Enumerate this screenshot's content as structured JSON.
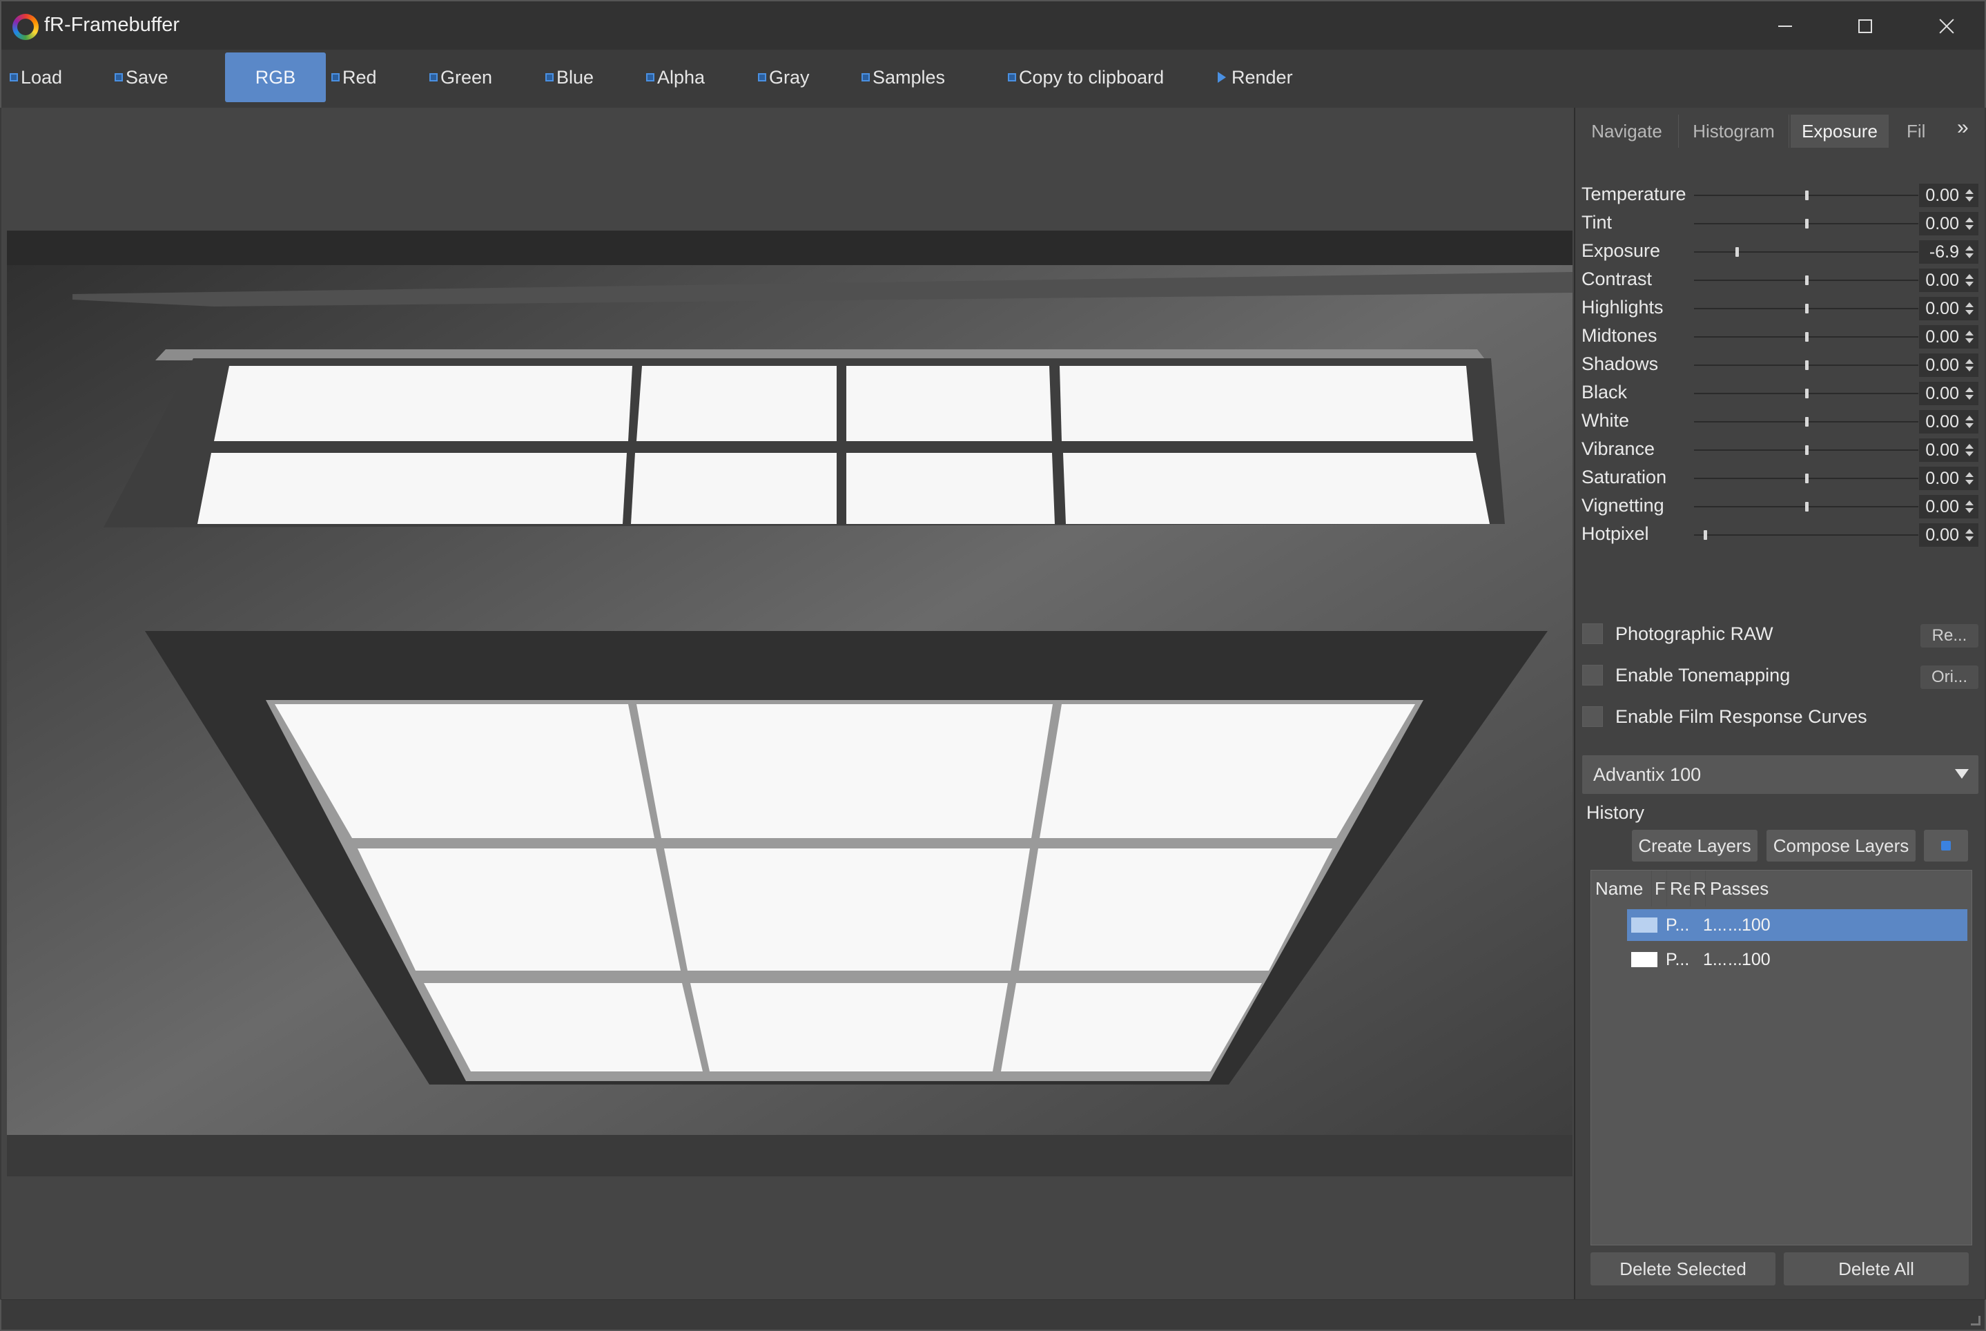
{
  "window": {
    "title": "fR-Framebuffer"
  },
  "toolbar": {
    "load": "Load",
    "save": "Save",
    "rgb": "RGB",
    "red": "Red",
    "green": "Green",
    "blue": "Blue",
    "alpha": "Alpha",
    "gray": "Gray",
    "samples": "Samples",
    "copy": "Copy to clipboard",
    "render": "Render",
    "active_channel": "RGB"
  },
  "tabs": [
    {
      "label": "Navigate"
    },
    {
      "label": "Histogram"
    },
    {
      "label": "Exposure",
      "active": true
    },
    {
      "label": "Fil"
    }
  ],
  "exposure": {
    "rows": [
      {
        "label": "Temperature",
        "value": "0.00",
        "level": 0.5
      },
      {
        "label": "Tint",
        "value": "0.00",
        "level": 0.5
      },
      {
        "label": "Exposure",
        "value": "-6.9",
        "level": 0.19
      },
      {
        "label": "Contrast",
        "value": "0.00",
        "level": 0.5
      },
      {
        "label": "Highlights",
        "value": "0.00",
        "level": 0.5
      },
      {
        "label": "Midtones",
        "value": "0.00",
        "level": 0.5
      },
      {
        "label": "Shadows",
        "value": "0.00",
        "level": 0.5
      },
      {
        "label": "Black",
        "value": "0.00",
        "level": 0.5
      },
      {
        "label": "White",
        "value": "0.00",
        "level": 0.5
      },
      {
        "label": "Vibrance",
        "value": "0.00",
        "level": 0.5
      },
      {
        "label": "Saturation",
        "value": "0.00",
        "level": 0.5
      },
      {
        "label": "Vignetting",
        "value": "0.00",
        "level": 0.5
      },
      {
        "label": "Hotpixel",
        "value": "0.00",
        "level": 0.05
      }
    ],
    "photographic_raw": {
      "label": "Photographic RAW",
      "checked": false,
      "button": "Re..."
    },
    "enable_tonemapping": {
      "label": "Enable Tonemapping",
      "checked": false,
      "button": "Ori..."
    },
    "enable_film_curves": {
      "label": "Enable Film Response Curves",
      "checked": false
    },
    "film_preset": "Advantix 100"
  },
  "history": {
    "title": "History",
    "create_layers": "Create Layers",
    "compose_layers": "Compose Layers",
    "columns": [
      "Name",
      "Fi",
      "Res",
      "Re",
      "Passes"
    ],
    "rows": [
      {
        "name": "P...",
        "res": "1...",
        "re": "...",
        "passes": "100",
        "selected": true
      },
      {
        "name": "P...",
        "res": "1...",
        "re": "...",
        "passes": "100",
        "selected": false
      }
    ],
    "delete_selected": "Delete Selected",
    "delete_all": "Delete All"
  },
  "colors": {
    "accent": "#5a88c8",
    "selection": "#5b87c5",
    "icon_blue": "#4a90e2"
  }
}
